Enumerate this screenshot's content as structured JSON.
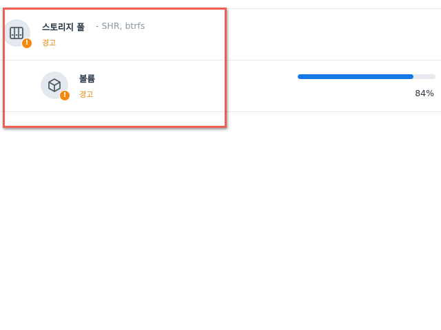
{
  "storage_pool": {
    "title": "스토리지 풀",
    "subtitle": "- SHR, btrfs",
    "status": "경고",
    "icon": "storage-pool-icon",
    "badge_icon": "warning-icon"
  },
  "volume": {
    "title": "볼륨",
    "status": "경고",
    "icon": "volume-cube-icon",
    "badge_icon": "warning-icon",
    "usage_percent": 84,
    "usage_label": "84%"
  },
  "colors": {
    "warning": "#f28a12",
    "progress": "#1479e6",
    "highlight": "#ee5f52"
  }
}
